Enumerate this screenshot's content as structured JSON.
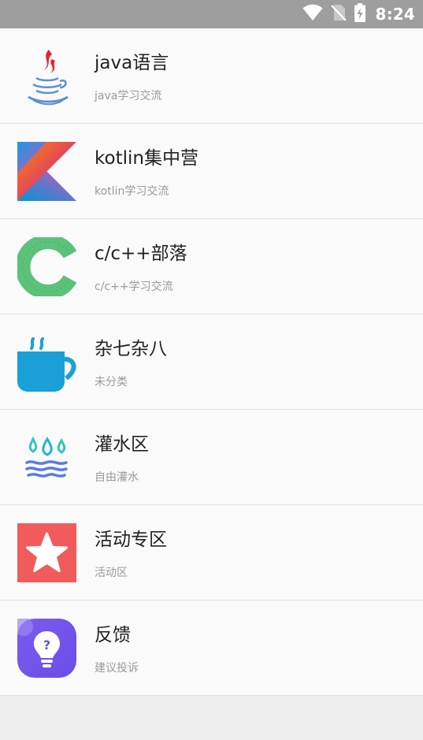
{
  "status_bar": {
    "time": "8:24",
    "icons": [
      "wifi-icon",
      "no-sim-icon",
      "battery-charging-icon"
    ]
  },
  "items": [
    {
      "title": "java语言",
      "subtitle": "java学习交流",
      "icon": "java-icon"
    },
    {
      "title": "kotlin集中营",
      "subtitle": "kotlin学习交流",
      "icon": "kotlin-icon"
    },
    {
      "title": "c/c++部落",
      "subtitle": "c/c++学习交流",
      "icon": "c-lang-icon"
    },
    {
      "title": "杂七杂八",
      "subtitle": "未分类",
      "icon": "coffee-cup-icon"
    },
    {
      "title": "灌水区",
      "subtitle": "自由灌水",
      "icon": "water-icon"
    },
    {
      "title": "活动专区",
      "subtitle": "活动区",
      "icon": "star-icon"
    },
    {
      "title": "反馈",
      "subtitle": "建议投诉",
      "icon": "feedback-lightbulb-icon"
    }
  ],
  "colors": {
    "status_bar": "#9e9e9e",
    "list_background": "#fafafa",
    "page_background": "#eeeeee",
    "title": "#222222",
    "subtitle": "#9a9a9a"
  }
}
